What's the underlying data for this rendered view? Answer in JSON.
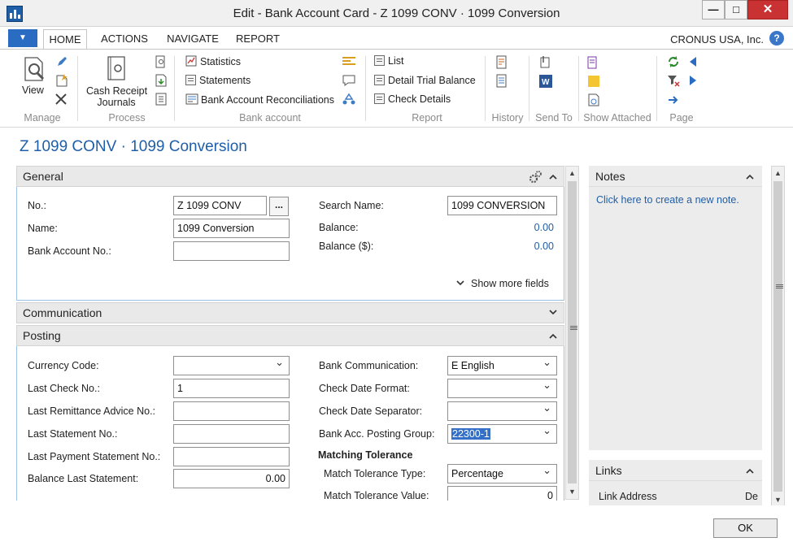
{
  "window": {
    "title": "Edit - Bank Account Card - Z 1099 CONV · 1099 Conversion",
    "minimize": "—",
    "maximize": "□",
    "close": "✕"
  },
  "ribbon_tabs": [
    {
      "label": "HOME",
      "active": true
    },
    {
      "label": "ACTIONS"
    },
    {
      "label": "NAVIGATE"
    },
    {
      "label": "REPORT"
    }
  ],
  "company": "CRONUS USA, Inc.",
  "help_label": "?",
  "menu_button": "▼",
  "ribbon": {
    "manage": {
      "label": "Manage",
      "view": "View"
    },
    "process": {
      "label": "Process",
      "cash_receipt_journals_line1": "Cash Receipt",
      "cash_receipt_journals_line2": "Journals"
    },
    "bank_account": {
      "label": "Bank account",
      "statistics": "Statistics",
      "statements": "Statements",
      "reconciliations": "Bank Account Reconciliations"
    },
    "report": {
      "label": "Report",
      "list": "List",
      "detail_trial_balance": "Detail Trial Balance",
      "check_details": "Check Details"
    },
    "history": {
      "label": "History"
    },
    "send_to": {
      "label": "Send To"
    },
    "show_attached": {
      "label": "Show Attached"
    },
    "page": {
      "label": "Page"
    }
  },
  "page_heading": "Z 1099 CONV · 1099 Conversion",
  "general": {
    "title": "General",
    "no_label": "No.:",
    "no_value": "Z 1099 CONV",
    "lookup": "...",
    "name_label": "Name:",
    "name_value": "1099 Conversion",
    "bank_account_no_label": "Bank Account No.:",
    "bank_account_no_value": "",
    "search_name_label": "Search Name:",
    "search_name_value": "1099 CONVERSION",
    "balance_label": "Balance:",
    "balance_value": "0.00",
    "balance_usd_label": "Balance ($):",
    "balance_usd_value": "0.00",
    "show_more": "Show more fields"
  },
  "communication": {
    "title": "Communication"
  },
  "posting": {
    "title": "Posting",
    "currency_code_label": "Currency Code:",
    "currency_code_value": "",
    "last_check_no_label": "Last Check No.:",
    "last_check_no_value": "1",
    "last_remittance_label": "Last Remittance Advice No.:",
    "last_remittance_value": "",
    "last_statement_label": "Last Statement No.:",
    "last_statement_value": "",
    "last_payment_statement_label": "Last Payment Statement No.:",
    "last_payment_statement_value": "",
    "balance_last_statement_label": "Balance Last Statement:",
    "balance_last_statement_value": "0.00",
    "bank_communication_label": "Bank Communication:",
    "bank_communication_value": "E English",
    "check_date_format_label": "Check Date Format:",
    "check_date_format_value": "",
    "check_date_separator_label": "Check Date Separator:",
    "check_date_separator_value": "",
    "posting_group_label": "Bank Acc. Posting Group:",
    "posting_group_value": "22300-1",
    "matching_tolerance_title": "Matching Tolerance",
    "match_type_label": "Match Tolerance Type:",
    "match_type_value": "Percentage",
    "match_value_label": "Match Tolerance Value:",
    "match_value_value": "0"
  },
  "notes": {
    "title": "Notes",
    "create_link": "Click here to create a new note."
  },
  "links": {
    "title": "Links",
    "col_address": "Link Address",
    "col_de": "De"
  },
  "ok_button": "OK"
}
